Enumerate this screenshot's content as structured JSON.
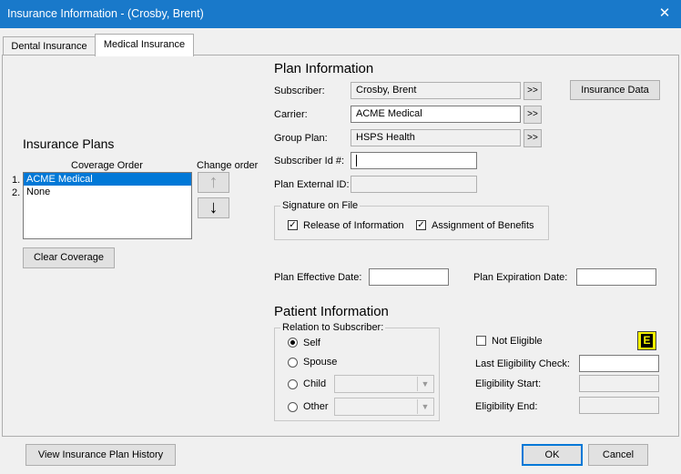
{
  "window": {
    "title": "Insurance Information - (Crosby, Brent)",
    "close_glyph": "✕"
  },
  "tabs": [
    {
      "label": "Dental Insurance"
    },
    {
      "label": "Medical Insurance"
    }
  ],
  "left": {
    "heading": "Insurance Plans",
    "coverage_order_label": "Coverage Order",
    "change_order_label": "Change order",
    "items": [
      {
        "num": "1.",
        "name": "ACME Medical"
      },
      {
        "num": "2.",
        "name": "None"
      }
    ],
    "clear_coverage": "Clear Coverage"
  },
  "plan": {
    "heading": "Plan Information",
    "subscriber_label": "Subscriber:",
    "subscriber_value": "Crosby, Brent",
    "carrier_label": "Carrier:",
    "carrier_value": "ACME Medical",
    "group_plan_label": "Group Plan:",
    "group_plan_value": "HSPS Health",
    "subscriber_id_label": "Subscriber Id #:",
    "subscriber_id_value": "",
    "plan_external_id_label": "Plan External ID:",
    "plan_external_id_value": "",
    "more_button": ">>",
    "insurance_data_button": "Insurance Data"
  },
  "signature": {
    "title": "Signature on File",
    "release_label": "Release of Information",
    "release_checked": true,
    "assignment_label": "Assignment of Benefits",
    "assignment_checked": true
  },
  "dates": {
    "effective_label": "Plan Effective Date:",
    "effective_value": "",
    "expiration_label": "Plan Expiration Date:",
    "expiration_value": ""
  },
  "patient": {
    "heading": "Patient Information",
    "relation_title": "Relation to Subscriber:",
    "options": [
      {
        "label": "Self",
        "selected": true
      },
      {
        "label": "Spouse",
        "selected": false
      },
      {
        "label": "Child",
        "selected": false
      },
      {
        "label": "Other",
        "selected": false
      }
    ],
    "not_eligible_label": "Not Eligible",
    "not_eligible_checked": false,
    "e_button": "E",
    "last_check_label": "Last Eligibility Check:",
    "last_check_value": "",
    "start_label": "Eligibility Start:",
    "start_value": "",
    "end_label": "Eligibility End:",
    "end_value": ""
  },
  "footer": {
    "history_button": "View Insurance Plan History",
    "ok_button": "OK",
    "cancel_button": "Cancel"
  },
  "colors": {
    "titlebar": "#1979ca",
    "selection": "#0078d7",
    "e_button": "#f6f200"
  }
}
